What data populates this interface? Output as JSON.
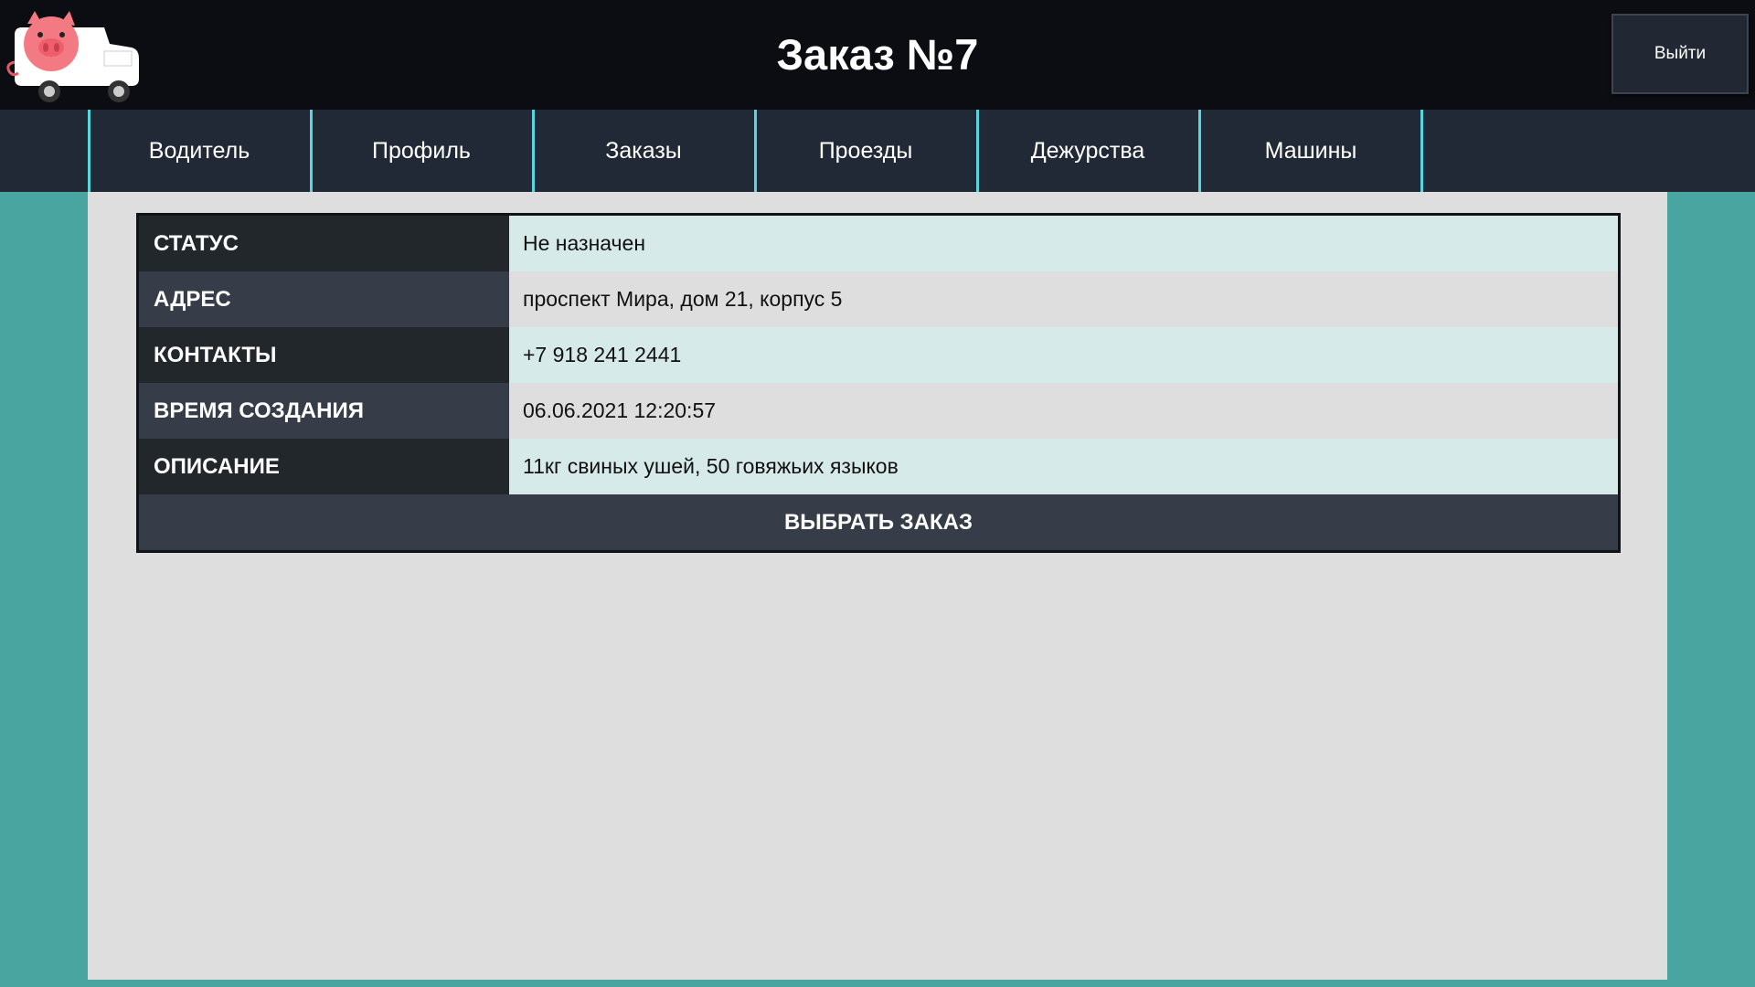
{
  "header": {
    "title": "Заказ №7",
    "logout_label": "Выйти"
  },
  "nav": {
    "items": [
      {
        "label": "Водитель"
      },
      {
        "label": "Профиль"
      },
      {
        "label": "Заказы"
      },
      {
        "label": "Проезды"
      },
      {
        "label": "Дежурства"
      },
      {
        "label": "Машины"
      }
    ]
  },
  "order": {
    "rows": [
      {
        "label": "СТАТУС",
        "value": "Не назначен"
      },
      {
        "label": "АДРЕС",
        "value": "проспект Мира, дом 21, корпус 5"
      },
      {
        "label": "КОНТАКТЫ",
        "value": "+7 918 241 2441"
      },
      {
        "label": "ВРЕМЯ СОЗДАНИЯ",
        "value": "06.06.2021 12:20:57"
      },
      {
        "label": "ОПИСАНИЕ",
        "value": "11кг свиных ушей, 50 говяжьих языков"
      }
    ],
    "select_label": "ВЫБРАТЬ ЗАКАЗ"
  },
  "colors": {
    "background": "#48a5a0",
    "header": "#0b0d12",
    "nav": "#222936",
    "nav_border": "#56d7de",
    "content": "#dedede"
  },
  "icons": {
    "logo": "pig-truck-logo"
  }
}
